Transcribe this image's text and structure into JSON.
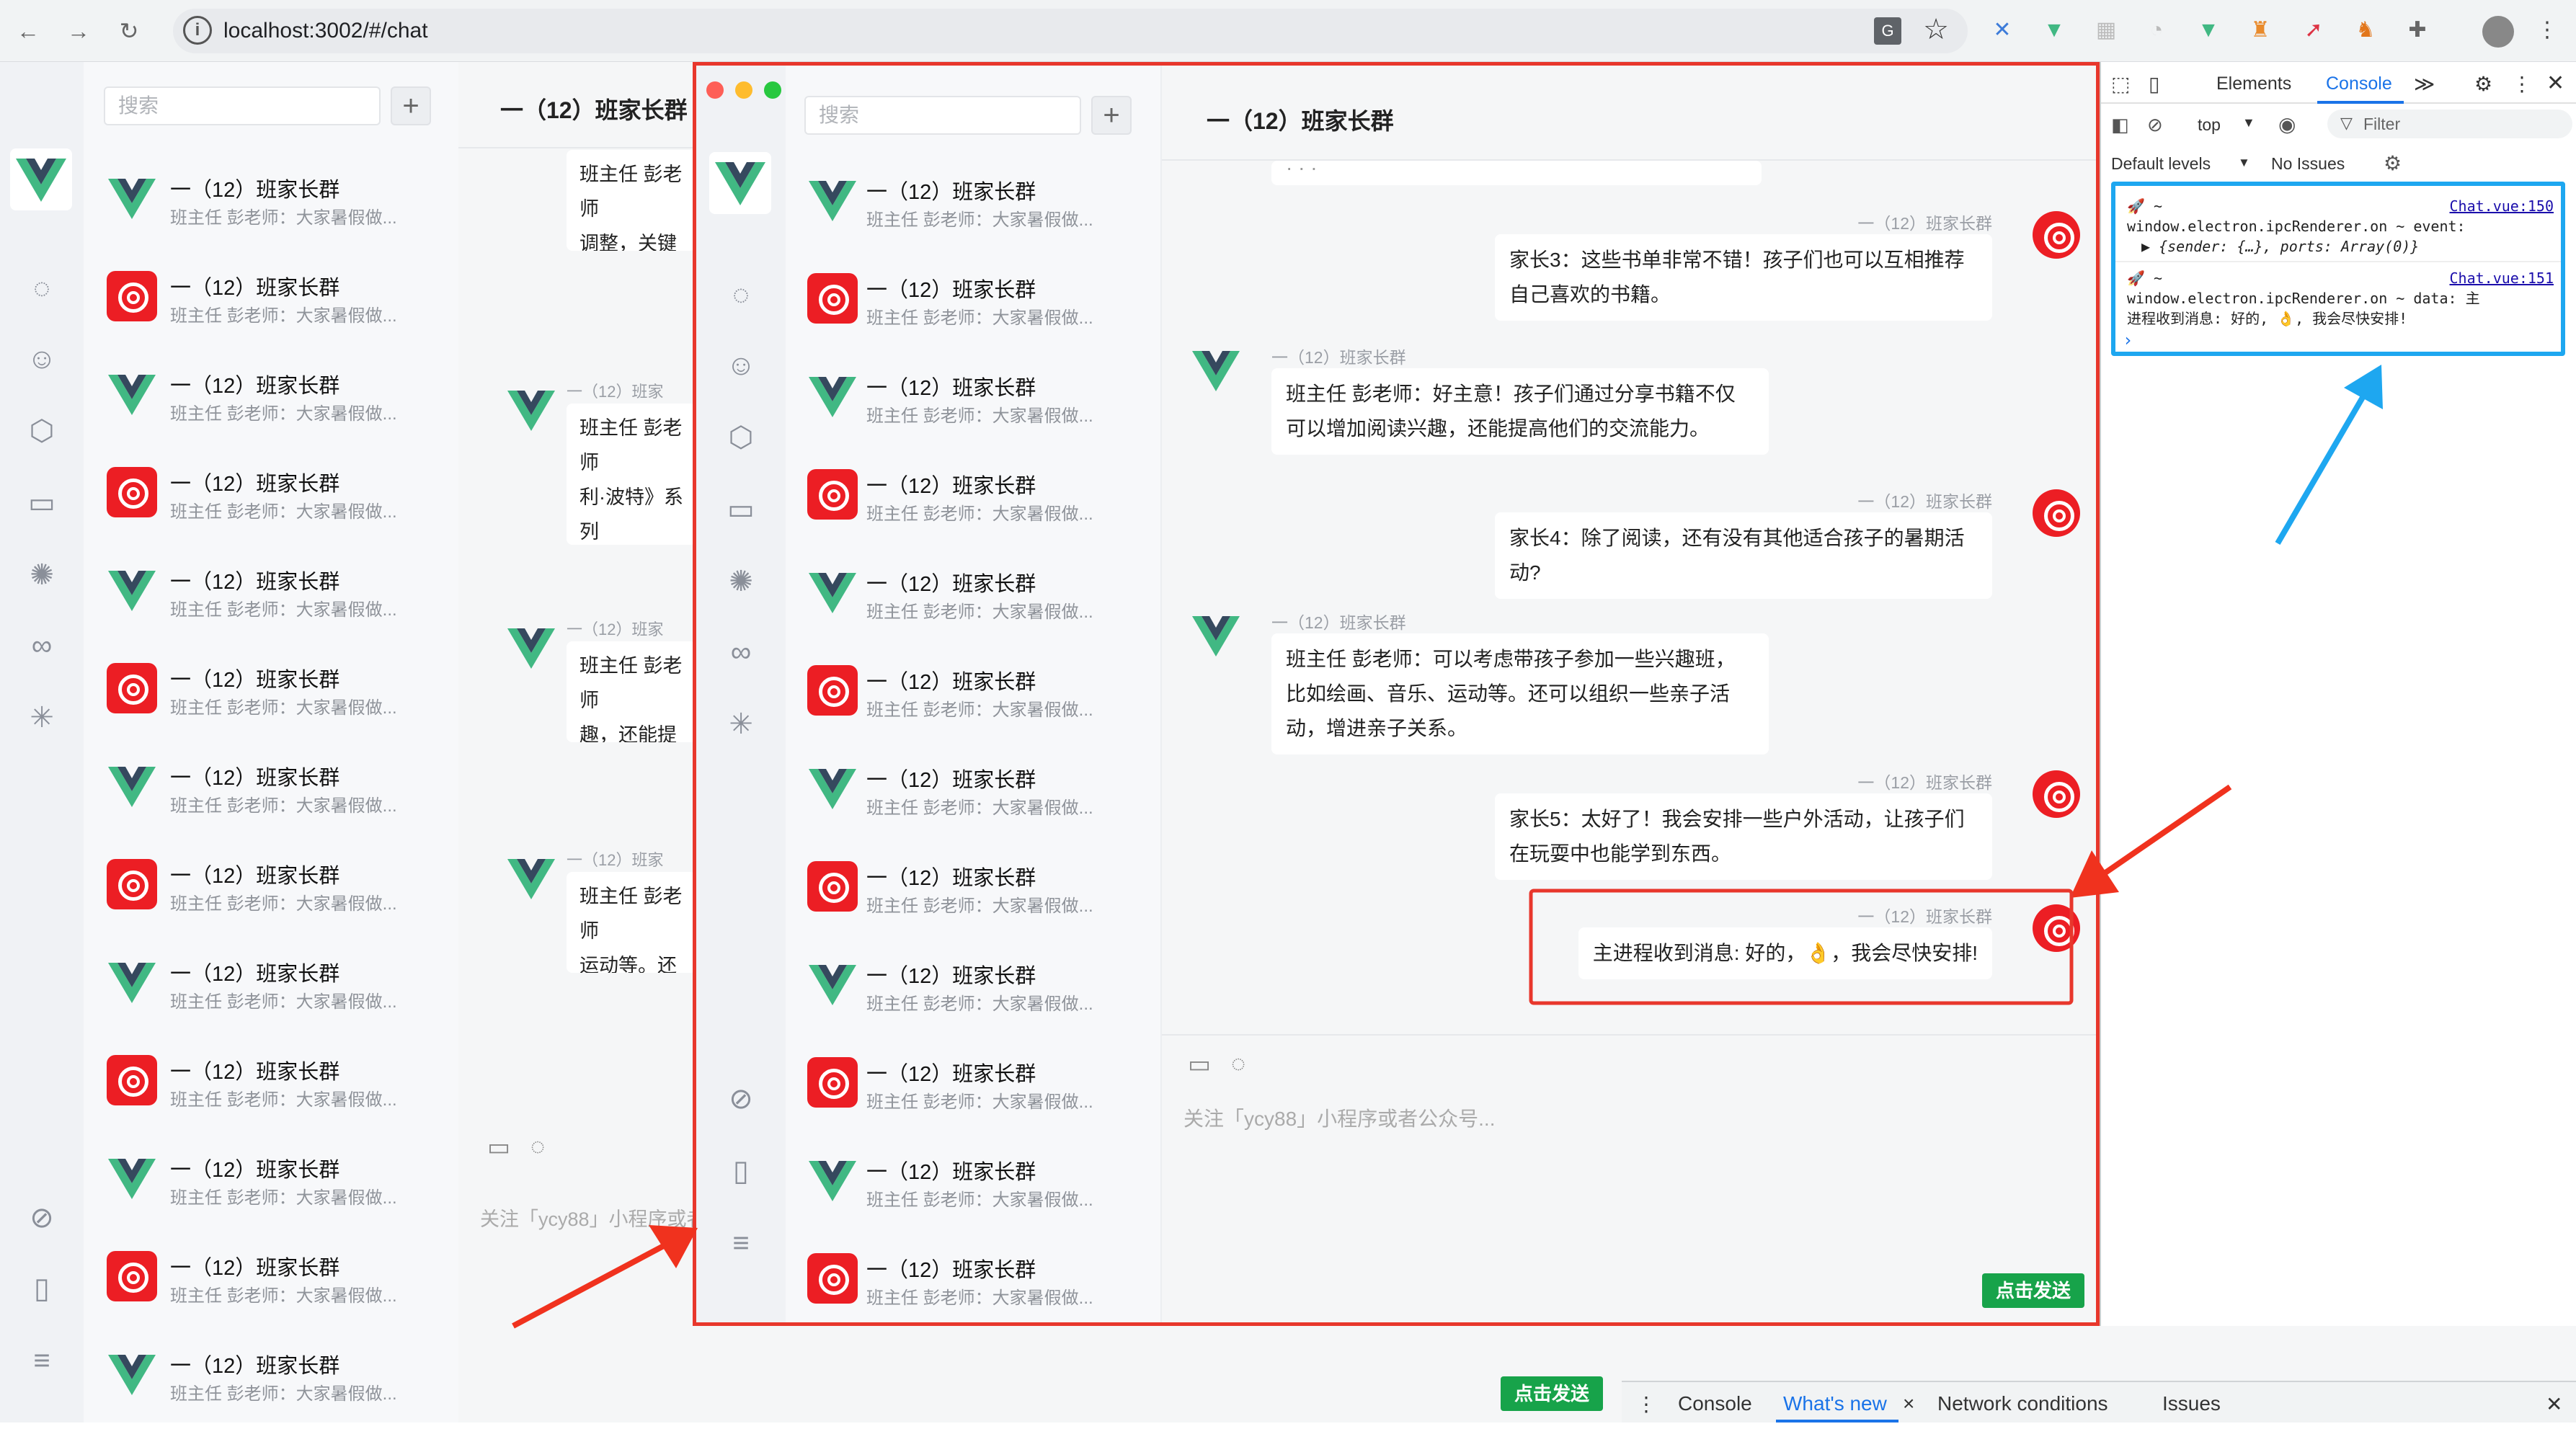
{
  "browser": {
    "url": "localhost:3002/#/chat",
    "nav": {
      "back": "←",
      "forward": "→",
      "reload": "↻"
    },
    "extensions_count": 9
  },
  "app": {
    "search_placeholder": "搜索",
    "add_label": "+",
    "chat_title": "一（12）班家长群",
    "input_placeholder": "关注「ycy88」小程序或者公众号...",
    "send_label": "点击发送"
  },
  "sidebar_rail": {
    "icons": [
      "chat-icon",
      "contacts-icon",
      "cube-icon",
      "folder-icon",
      "aperture-icon",
      "infinity-icon",
      "sparkle-icon",
      "link-icon",
      "phone-icon",
      "menu-icon"
    ]
  },
  "chat_list": [
    {
      "title": "一（12）班家长群",
      "preview": "班主任 彭老师：大家暑假做...",
      "avatar": "vue"
    },
    {
      "title": "一（12）班家长群",
      "preview": "班主任 彭老师：大家暑假做...",
      "avatar": "netease"
    },
    {
      "title": "一（12）班家长群",
      "preview": "班主任 彭老师：大家暑假做...",
      "avatar": "vue"
    },
    {
      "title": "一（12）班家长群",
      "preview": "班主任 彭老师：大家暑假做...",
      "avatar": "netease"
    },
    {
      "title": "一（12）班家长群",
      "preview": "班主任 彭老师：大家暑假做...",
      "avatar": "vue"
    },
    {
      "title": "一（12）班家长群",
      "preview": "班主任 彭老师：大家暑假做...",
      "avatar": "netease"
    },
    {
      "title": "一（12）班家长群",
      "preview": "班主任 彭老师：大家暑假做...",
      "avatar": "vue"
    },
    {
      "title": "一（12）班家长群",
      "preview": "班主任 彭老师：大家暑假做...",
      "avatar": "netease"
    },
    {
      "title": "一（12）班家长群",
      "preview": "班主任 彭老师：大家暑假做...",
      "avatar": "vue"
    },
    {
      "title": "一（12）班家长群",
      "preview": "班主任 彭老师：大家暑假做...",
      "avatar": "netease"
    },
    {
      "title": "一（12）班家长群",
      "preview": "班主任 彭老师：大家暑假做...",
      "avatar": "vue"
    },
    {
      "title": "一（12）班家长群",
      "preview": "班主任 彭老师：大家暑假做...",
      "avatar": "netease"
    },
    {
      "title": "一（12）班家长群",
      "preview": "班主任 彭老师：大家暑假做...",
      "avatar": "vue"
    }
  ],
  "background_messages": [
    {
      "sender": "一（12）班家",
      "text": "班主任 彭老师\n调整，关键是"
    },
    {
      "sender": "一（12）班家",
      "text": "班主任 彭老师\n利·波特》系列\n故事书。"
    },
    {
      "sender": "一（12）班家",
      "text": "班主任 彭老师\n趣，还能提高"
    },
    {
      "sender": "一（12）班家",
      "text": "班主任 彭老师\n运动等。还可"
    }
  ],
  "messages": [
    {
      "side": "right",
      "sender": "一（12）班家长群",
      "text": "家长3：这些书单非常不错！孩子们也可以互相推荐自己喜欢的书籍。"
    },
    {
      "side": "left",
      "sender": "一（12）班家长群",
      "text": "班主任 彭老师：好主意！孩子们通过分享书籍不仅可以增加阅读兴趣，还能提高他们的交流能力。"
    },
    {
      "side": "right",
      "sender": "一（12）班家长群",
      "text": "家长4：除了阅读，还有没有其他适合孩子的暑期活动?"
    },
    {
      "side": "left",
      "sender": "一（12）班家长群",
      "text": "班主任 彭老师：可以考虑带孩子参加一些兴趣班，比如绘画、音乐、运动等。还可以组织一些亲子活动，增进亲子关系。"
    },
    {
      "side": "right",
      "sender": "一（12）班家长群",
      "text": "家长5：太好了！我会安排一些户外活动，让孩子们在玩耍中也能学到东西。"
    },
    {
      "side": "right",
      "sender": "一（12）班家长群",
      "text": "主进程收到消息: 好的，👌，我会尽快安排!",
      "highlighted": true
    }
  ],
  "devtools": {
    "tabs": [
      "Elements",
      "Console"
    ],
    "active_tab": "Console",
    "more": "≫",
    "context": "top",
    "filter_placeholder": "Filter",
    "levels": "Default levels",
    "issues": "No Issues",
    "logs": [
      {
        "prefix": "🚀 ~",
        "link": "Chat.vue:150",
        "line1": "window.electron.ipcRenderer.on ~ event:",
        "line2": "▶ {sender: {…}, ports: Array(0)}"
      },
      {
        "prefix": "🚀 ~",
        "link": "Chat.vue:151",
        "line1": "window.electron.ipcRenderer.on ~ data: 主",
        "line2": "进程收到消息: 好的, 👌, 我会尽快安排!"
      }
    ],
    "prompt": "›"
  },
  "drawer": {
    "tabs": [
      "Console",
      "What's new",
      "Network conditions",
      "Issues"
    ],
    "active": "What's new",
    "close": "×"
  },
  "colors": {
    "accent_red": "#e8372c",
    "send_green": "#17a34a",
    "annotation_blue": "#1ea7f0",
    "vue_green": "#41b883",
    "vue_dark": "#35495e"
  }
}
